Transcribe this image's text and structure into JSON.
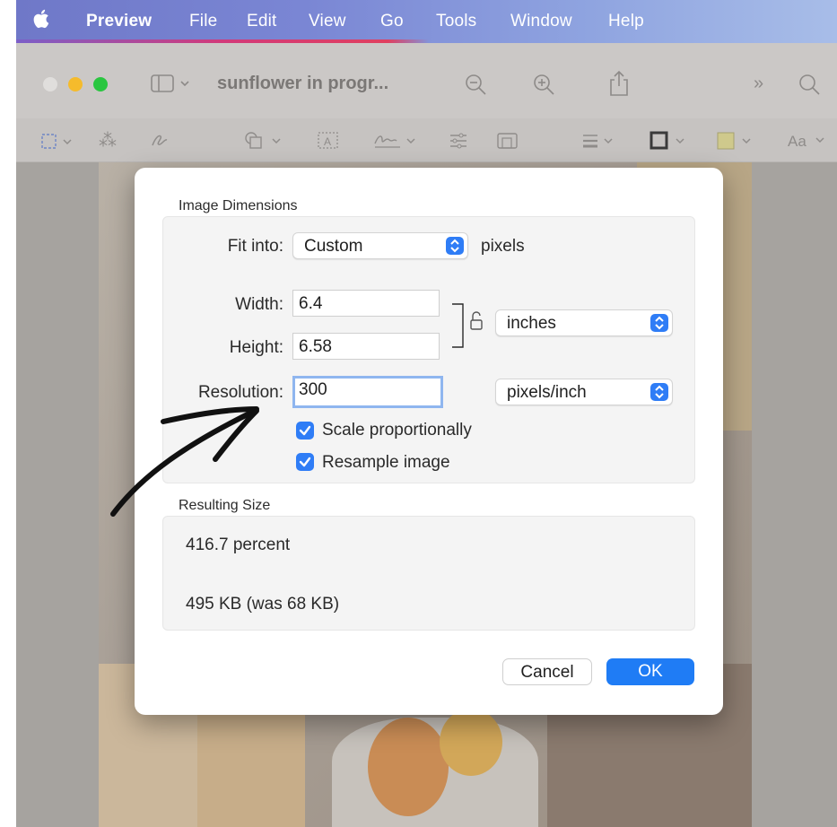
{
  "menubar": {
    "app": "Preview",
    "items": [
      "File",
      "Edit",
      "View",
      "Go",
      "Tools",
      "Window",
      "Help"
    ]
  },
  "window": {
    "title": "sunflower in progr...",
    "icons": [
      "sidebar-icon",
      "zoom-out-icon",
      "zoom-in-icon",
      "share-icon",
      "more-icon",
      "search-icon"
    ],
    "markup_icons": [
      "selection-icon",
      "instant-alpha-icon",
      "sketch-icon",
      "shapes-icon",
      "text-icon",
      "sign-icon",
      "adjust-color-icon",
      "adjust-size-icon",
      "line-style-icon",
      "border-color-icon",
      "fill-color-icon",
      "text-style-icon"
    ],
    "text_style_label": "Aa"
  },
  "dialog": {
    "image_dimensions_label": "Image Dimensions",
    "fit_into_label": "Fit into:",
    "fit_into_value": "Custom",
    "fit_into_unit": "pixels",
    "width_label": "Width:",
    "width_value": "6.4",
    "height_label": "Height:",
    "height_value": "6.58",
    "size_unit": "inches",
    "resolution_label": "Resolution:",
    "resolution_value": "300",
    "resolution_unit": "pixels/inch",
    "scale_proportionally_label": "Scale proportionally",
    "scale_proportionally_checked": true,
    "resample_label": "Resample image",
    "resample_checked": true,
    "resulting_size_label": "Resulting Size",
    "percent_text": "416.7 percent",
    "size_text": "495 KB (was 68 KB)",
    "cancel_label": "Cancel",
    "ok_label": "OK"
  },
  "colors": {
    "accent": "#1f7cf5",
    "close": "#e0e0e0",
    "minimize": "#f5bb2c",
    "zoom": "#2ac640",
    "annotation_ink": "#111111"
  }
}
